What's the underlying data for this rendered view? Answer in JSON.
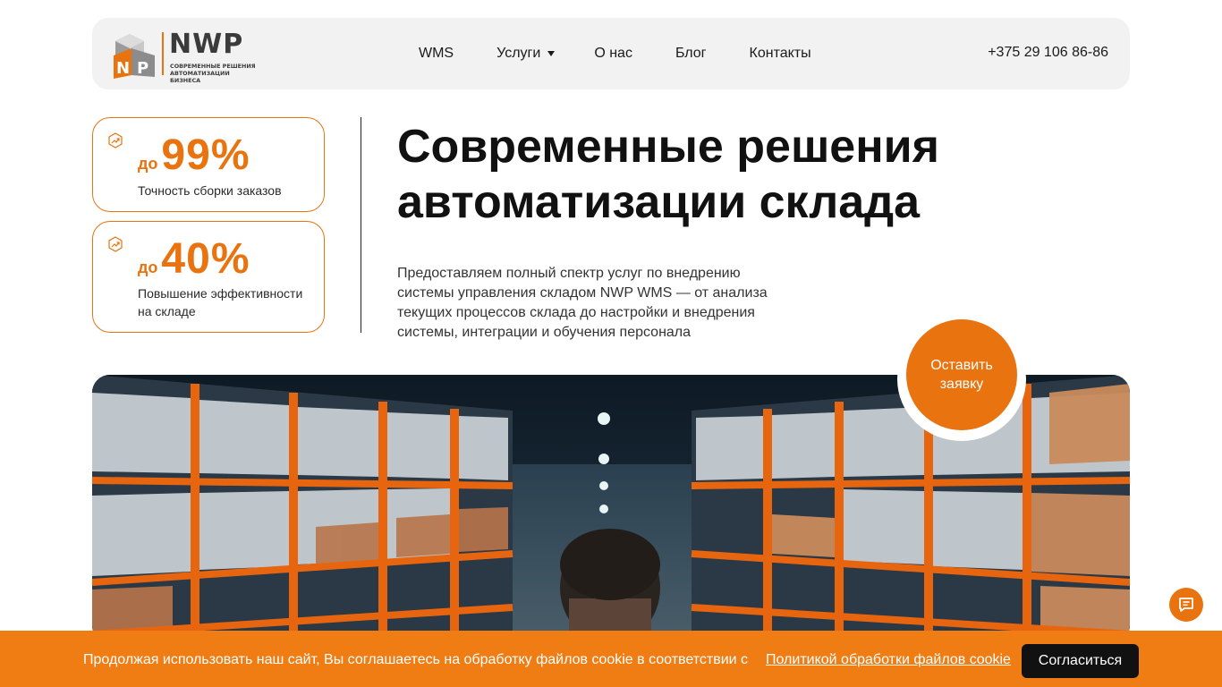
{
  "header": {
    "logo_title": "NWP",
    "logo_subtitle_line1": "СОВРЕМЕННЫЕ РЕШЕНИЯ",
    "logo_subtitle_line2": "АВТОМАТИЗАЦИИ БИЗНЕСА",
    "nav": [
      {
        "label": "WMS"
      },
      {
        "label": "Услуги",
        "has_dropdown": true
      },
      {
        "label": "О нас"
      },
      {
        "label": "Блог"
      },
      {
        "label": "Контакты"
      }
    ],
    "phone": "+375 29 106 86-86"
  },
  "stats": [
    {
      "prefix": "до",
      "value": "99%",
      "label": "Точность сборки заказов",
      "icon": "trend-up-icon"
    },
    {
      "prefix": "до",
      "value": "40%",
      "label": "Повышение эффективности на складе",
      "icon": "trend-up-icon"
    }
  ],
  "hero": {
    "title_line1": "Современные решения",
    "title_line2": "автоматизации склада",
    "description": "Предоставляем полный спектр услуг по внедрению системы управления складом NWP WMS — от анализа текущих процессов склада до настройки и внедрения системы, интеграции и обучения персонала",
    "cta_label": "Оставить заявку"
  },
  "chat": {
    "icon": "chat-icon"
  },
  "cookie": {
    "text": "Продолжая использовать наш сайт, Вы соглашаетесь на обработку файлов cookie в соответствии с",
    "link": "Политикой обработки файлов cookie",
    "accept": "Согласиться"
  },
  "colors": {
    "accent": "#e8730f",
    "cookie_bar": "#f07d14",
    "header_bg": "#f2f2f2",
    "dark": "#111111"
  }
}
